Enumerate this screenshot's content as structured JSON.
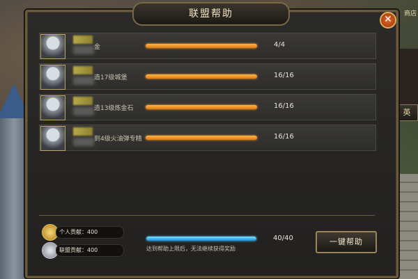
{
  "panel": {
    "title": "联盟帮助"
  },
  "background": {
    "shop_label": "商店",
    "hero_label": "英"
  },
  "help_rows": [
    {
      "task": "金",
      "count": "4/4"
    },
    {
      "task": "造17级城堡",
      "count": "16/16"
    },
    {
      "task": "造13级炼金石",
      "count": "16/16"
    },
    {
      "task": "到4级火油弹专精",
      "count": "16/16"
    }
  ],
  "footer": {
    "personal_contribution": "个人贡献：400",
    "alliance_contribution": "联盟贡献：400",
    "total_count": "40/40",
    "limit_notice": "达到帮助上限后，无法继续获得奖励",
    "one_click_help_label": "一键帮助"
  },
  "colors": {
    "progress_orange": "#f08a20",
    "progress_blue": "#2aa0e8",
    "frame_gold": "#9a8658"
  }
}
